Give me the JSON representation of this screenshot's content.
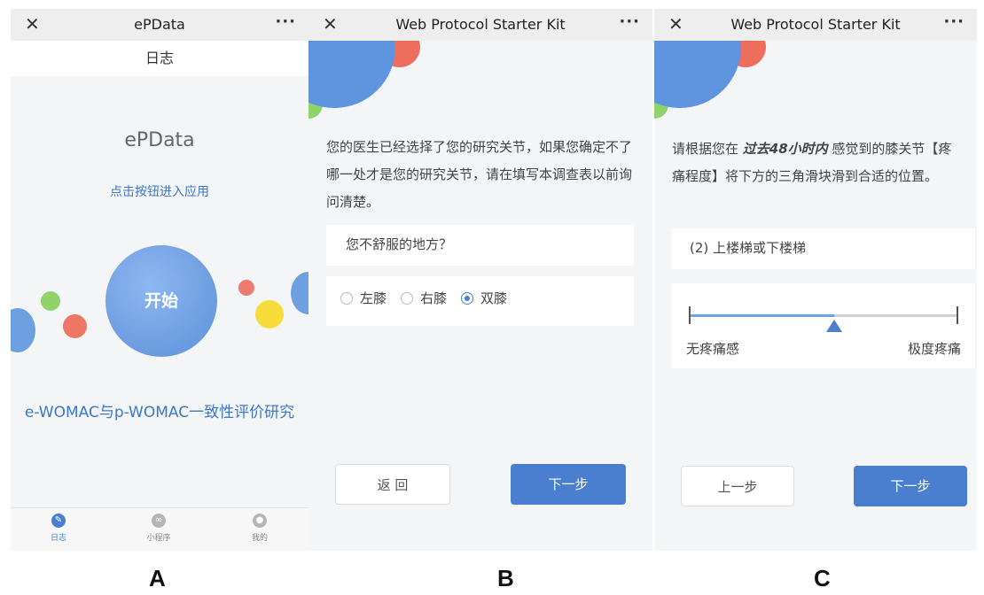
{
  "panel_a": {
    "window_title": "ePData",
    "close_glyph": "✕",
    "more_glyph": "···",
    "subheader": "日志",
    "app_name": "ePData",
    "enter_link": "点击按钮进入应用",
    "start_label": "开始",
    "study_title": "e-WOMAC与p-WOMAC一致性评价研究",
    "tabs": [
      {
        "label": "日志",
        "icon": "pen-icon",
        "active": true
      },
      {
        "label": "小程序",
        "icon": "miniprogram-icon",
        "active": false
      },
      {
        "label": "我的",
        "icon": "user-icon",
        "active": false
      }
    ]
  },
  "panel_b": {
    "window_title": "Web Protocol Starter Kit",
    "close_glyph": "✕",
    "more_glyph": "···",
    "instruction": "您的医生已经选择了您的研究关节，如果您确定不了哪一处才是您的研究关节，请在填写本调查表以前询问清楚。",
    "question": "您不舒服的地方？",
    "options": [
      "左膝",
      "右膝",
      "双膝"
    ],
    "selected_option": "双膝",
    "back_label": "返 回",
    "next_label": "下一步"
  },
  "panel_c": {
    "window_title": "Web Protocol Starter Kit",
    "close_glyph": "✕",
    "more_glyph": "···",
    "instruction_pre": "请根据您在 ",
    "instruction_emphasis": "过去48小时内",
    "instruction_post": " 感觉到的膝关节【疼痛程度】将下方的三角滑块滑到合适的位置。",
    "question": "(2) 上楼梯或下楼梯",
    "slider_min_label": "无疼痛感",
    "slider_max_label": "极度疼痛",
    "slider_value_fraction": 0.54,
    "prev_label": "上一步",
    "next_label": "下一步"
  },
  "figure_labels": [
    "A",
    "B",
    "C"
  ],
  "colors": {
    "accent": "#4a7fd0",
    "link": "#3b78c9",
    "slider_fill": "#6aa3e8",
    "background": "#f4f5f7"
  }
}
